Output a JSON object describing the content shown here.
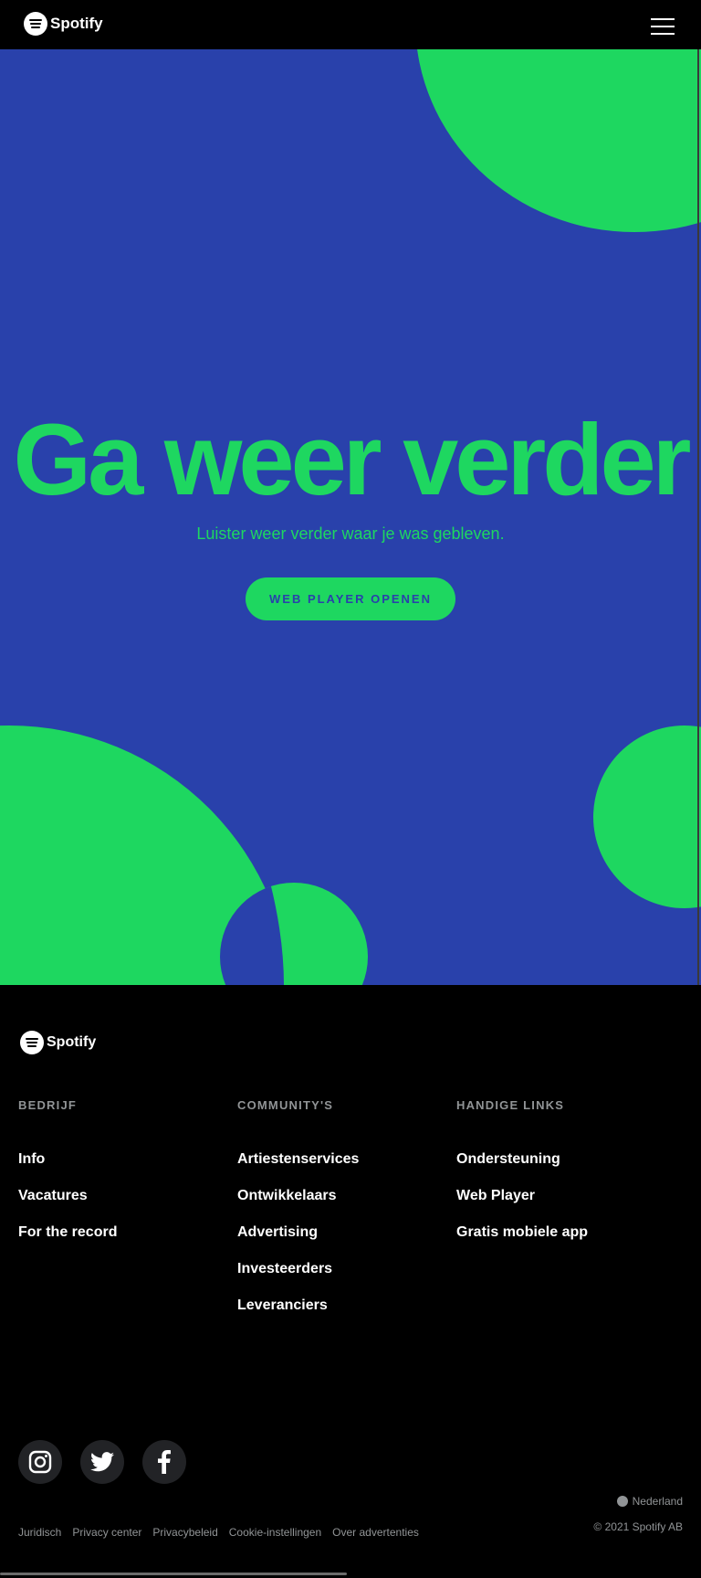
{
  "header": {
    "logo_text": "Spotify",
    "menu_icon": "hamburger-menu-icon"
  },
  "hero": {
    "title": "Ga weer verder",
    "subtitle": "Luister weer verder waar je was gebleven.",
    "cta_label": "WEB PLAYER OPENEN",
    "colors": {
      "background": "#2941ab",
      "accent": "#1ed760"
    }
  },
  "footer": {
    "logo_text": "Spotify",
    "columns": [
      {
        "title": "BEDRIJF",
        "links": [
          "Info",
          "Vacatures",
          "For the record"
        ]
      },
      {
        "title": "COMMUNITY'S",
        "links": [
          "Artiestenservices",
          "Ontwikkelaars",
          "Advertising",
          "Investeerders",
          "Leveranciers"
        ]
      },
      {
        "title": "HANDIGE LINKS",
        "links": [
          "Ondersteuning",
          "Web Player",
          "Gratis mobiele app"
        ]
      }
    ],
    "social_icons": [
      "instagram-icon",
      "twitter-icon",
      "facebook-icon"
    ],
    "country": "Nederland",
    "copyright": "© 2021 Spotify AB",
    "legal_links": [
      "Juridisch",
      "Privacy center",
      "Privacybeleid",
      "Cookie-instellingen",
      "Over advertenties"
    ]
  }
}
